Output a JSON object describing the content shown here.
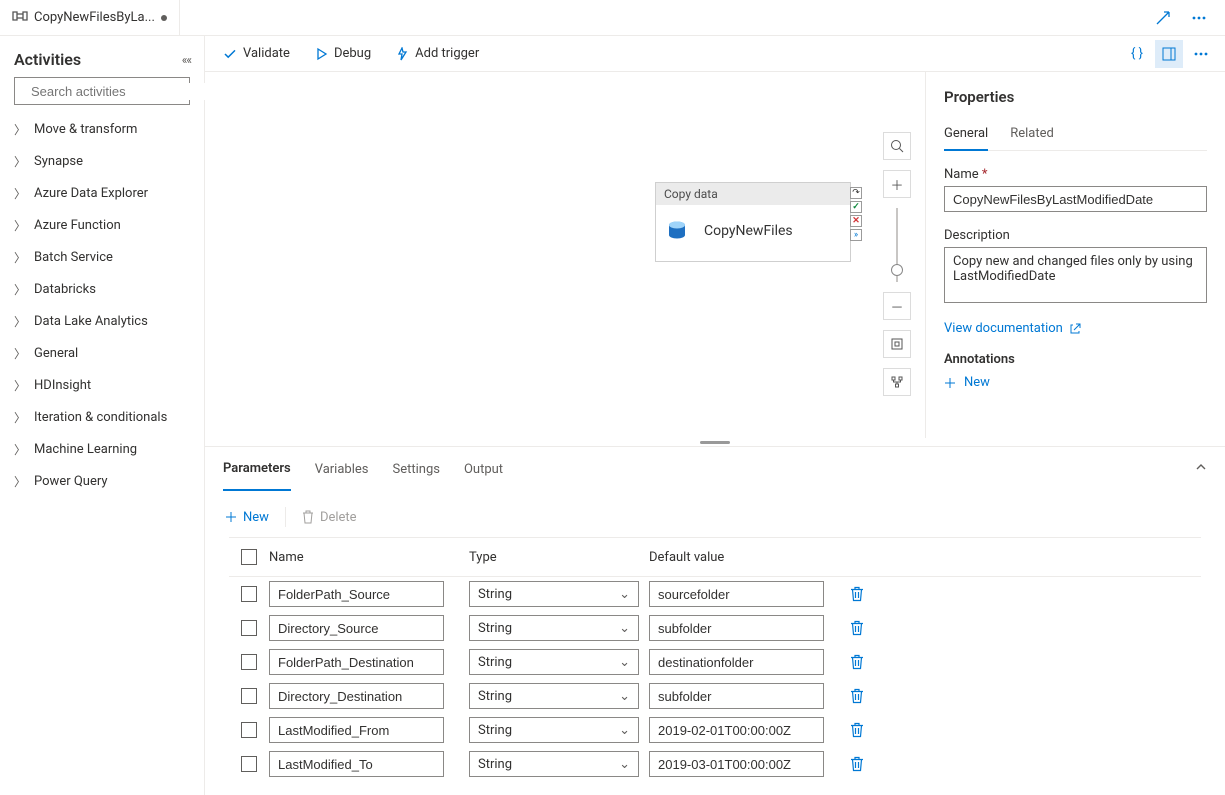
{
  "tab": {
    "title": "CopyNewFilesByLa...",
    "dirty": true
  },
  "sidebar": {
    "title": "Activities",
    "search_placeholder": "Search activities",
    "items": [
      "Move & transform",
      "Synapse",
      "Azure Data Explorer",
      "Azure Function",
      "Batch Service",
      "Databricks",
      "Data Lake Analytics",
      "General",
      "HDInsight",
      "Iteration & conditionals",
      "Machine Learning",
      "Power Query"
    ]
  },
  "toolbar": {
    "validate": "Validate",
    "debug": "Debug",
    "add_trigger": "Add trigger"
  },
  "canvas_node": {
    "type": "Copy data",
    "name": "CopyNewFiles"
  },
  "details": {
    "tabs": {
      "parameters": "Parameters",
      "variables": "Variables",
      "settings": "Settings",
      "output": "Output"
    },
    "ops": {
      "new": "New",
      "delete": "Delete"
    },
    "columns": {
      "name": "Name",
      "type": "Type",
      "default": "Default value"
    },
    "rows": [
      {
        "name": "FolderPath_Source",
        "type": "String",
        "default": "sourcefolder"
      },
      {
        "name": "Directory_Source",
        "type": "String",
        "default": "subfolder"
      },
      {
        "name": "FolderPath_Destination",
        "type": "String",
        "default": "destinationfolder"
      },
      {
        "name": "Directory_Destination",
        "type": "String",
        "default": "subfolder"
      },
      {
        "name": "LastModified_From",
        "type": "String",
        "default": "2019-02-01T00:00:00Z"
      },
      {
        "name": "LastModified_To",
        "type": "String",
        "default": "2019-03-01T00:00:00Z"
      }
    ]
  },
  "properties": {
    "title": "Properties",
    "tabs": {
      "general": "General",
      "related": "Related"
    },
    "name_label": "Name",
    "name_value": "CopyNewFilesByLastModifiedDate",
    "desc_label": "Description",
    "desc_value": "Copy new and changed files only by using LastModifiedDate",
    "doc_link": "View documentation",
    "annotations_label": "Annotations",
    "new": "New"
  }
}
